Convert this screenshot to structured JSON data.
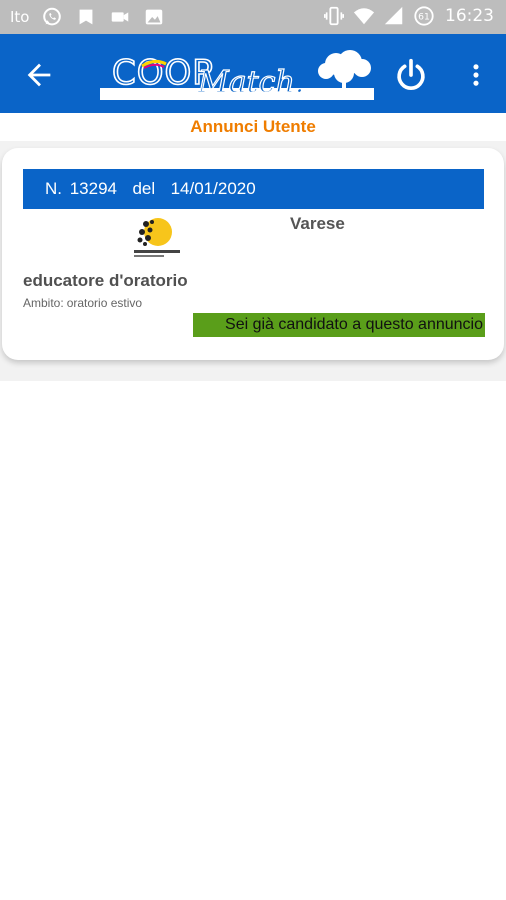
{
  "status_bar": {
    "carrier": "Ito",
    "time": "16:23",
    "icons": [
      "whatsapp-icon",
      "notification-icon",
      "camera-video-icon",
      "image-icon",
      "vibrate-icon",
      "wifi-icon",
      "signal-icon",
      "battery-icon"
    ]
  },
  "app_bar": {
    "logo_text": "COOPMATCH",
    "colors": {
      "primary": "#0a64c8",
      "accent": "#ef7d00"
    }
  },
  "page": {
    "title": "Annunci Utente"
  },
  "listing": {
    "number_label": "N. 13294",
    "date_prefix": "del",
    "date": "14/01/2020",
    "city": "Varese",
    "title": "educatore d'oratorio",
    "ambito_label": "Ambito:",
    "ambito_value": "oratorio estivo",
    "status": "Sei già candidato a questo annuncio"
  }
}
